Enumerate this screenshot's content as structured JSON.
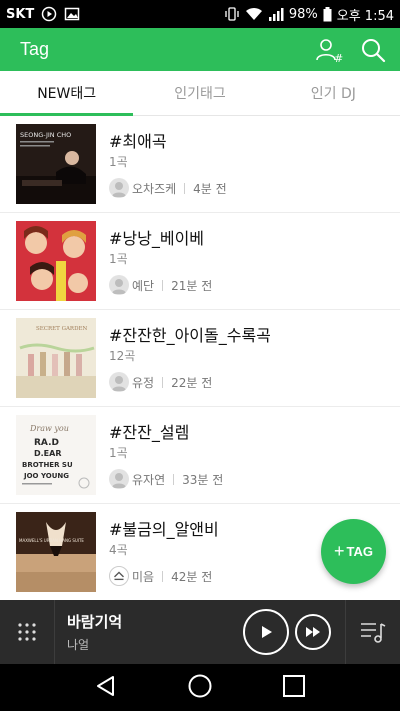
{
  "status_bar": {
    "carrier": "SKT",
    "battery": "98%",
    "time": "오후 1:54"
  },
  "app_bar": {
    "title": "Tag",
    "actions": [
      "user-tag-icon",
      "search-icon"
    ]
  },
  "tabs": [
    {
      "label": "NEW태그",
      "active": true
    },
    {
      "label": "인기태그",
      "active": false
    },
    {
      "label": "인기 DJ",
      "active": false
    }
  ],
  "tags": [
    {
      "title": "#최애곡",
      "count": "1곡",
      "user": "오차즈케",
      "time": "4분 전",
      "cover_text": "SEONG-JIN CHO"
    },
    {
      "title": "#낭낭_베이베",
      "count": "1곡",
      "user": "예단",
      "time": "21분 전",
      "cover_text": ""
    },
    {
      "title": "#잔잔한_아이돌_수록곡",
      "count": "12곡",
      "user": "유정",
      "time": "22분 전",
      "cover_text": "SECRET GARDEN"
    },
    {
      "title": "#잔잔_설렘",
      "count": "1곡",
      "user": "유자연",
      "time": "33분 전",
      "cover_text": "RAD DEAR BROTHER SU JOO YOUNG"
    },
    {
      "title": "#불금의_알앤비",
      "count": "4곡",
      "user": "미음",
      "time": "42분 전",
      "cover_text": "MAXWELL'S URBAN HANG SUITE"
    }
  ],
  "fab": {
    "label": "TAG"
  },
  "player": {
    "title": "바람기억",
    "artist": "나얼"
  },
  "colors": {
    "accent": "#2dbe5a",
    "player_bg": "#2b2b2b"
  }
}
